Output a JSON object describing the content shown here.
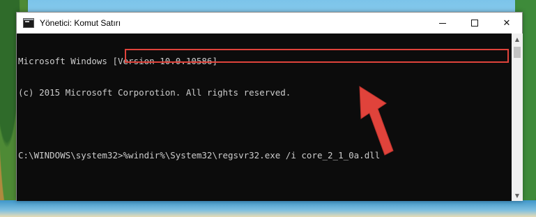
{
  "window": {
    "title": "Yönetici: Komut Satırı",
    "controls": {
      "minimize_icon": "minimize-icon",
      "maximize_icon": "maximize-icon",
      "close_symbol": "✕"
    }
  },
  "console": {
    "lines": [
      "Microsoft Windows [Version 10.0.10586]",
      "(c) 2015 Microsoft Corporotion. All rights reserved.",
      ""
    ],
    "prompt": "C:\\WINDOWS\\system32>",
    "command": "%windir%\\System32\\regsvr32.exe /i core_2_1_0a.dll"
  },
  "scrollbar": {
    "up_symbol": "▲",
    "down_symbol": "▼"
  },
  "annotation": {
    "highlight_color": "#e0433b",
    "arrow_color": "#e0433b"
  },
  "colors": {
    "console_bg": "#0c0c0c",
    "console_text": "#cccccc",
    "title_bar": "#ffffff"
  }
}
